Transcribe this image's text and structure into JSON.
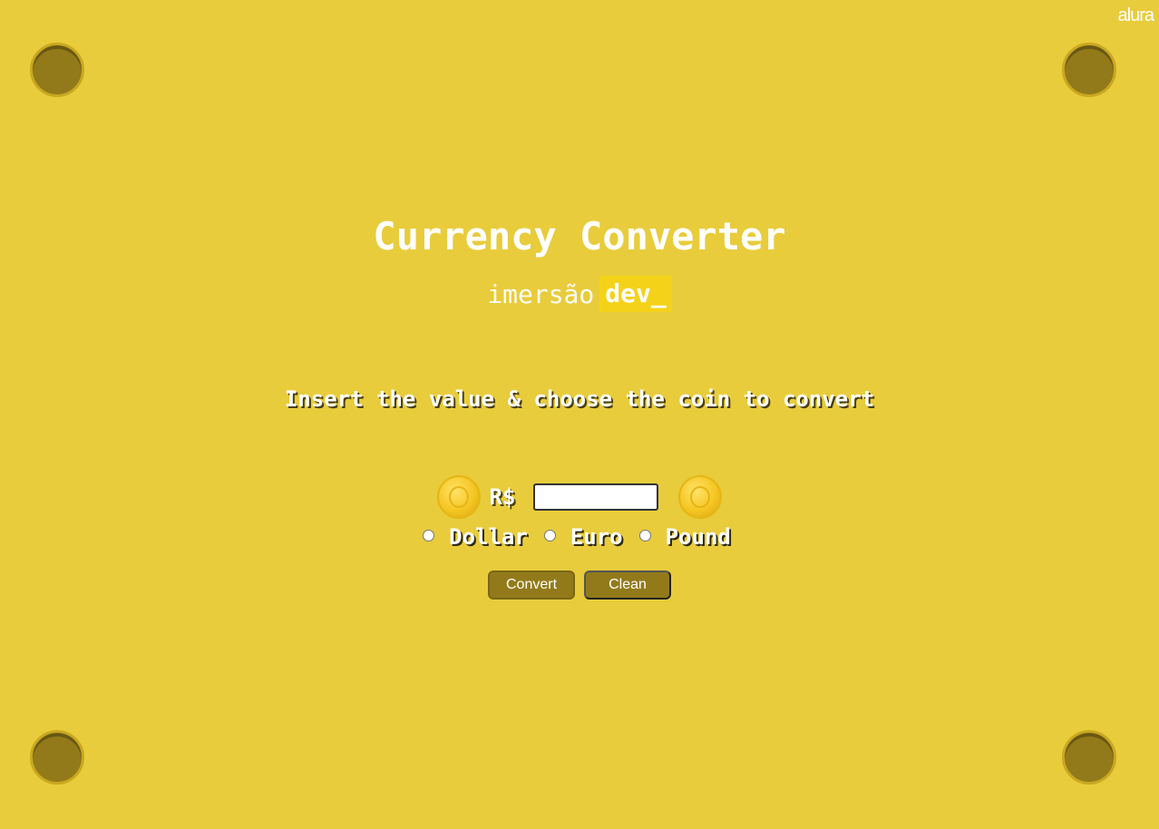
{
  "brand": {
    "corner_logo": "alura",
    "event_light": "imersão",
    "event_bold": "dev_"
  },
  "header": {
    "title": "Currency Converter"
  },
  "form": {
    "instruction": "Insert the value & choose the coin to convert",
    "currency_symbol": "R$",
    "value_input": {
      "value": "",
      "placeholder": ""
    },
    "options": [
      {
        "label": "Dollar",
        "checked": false
      },
      {
        "label": "Euro",
        "checked": false
      },
      {
        "label": "Pound",
        "checked": false
      }
    ],
    "convert_label": "Convert",
    "clean_label": "Clean"
  },
  "colors": {
    "background": "#e8cc3c",
    "button": "#927a1a",
    "screw": "#927a1a",
    "brand_box": "#f5d21a"
  },
  "icons": {
    "coin_left": "gold-coin-icon",
    "coin_right": "gold-coin-icon",
    "corner_decorations": "screw-icon"
  }
}
